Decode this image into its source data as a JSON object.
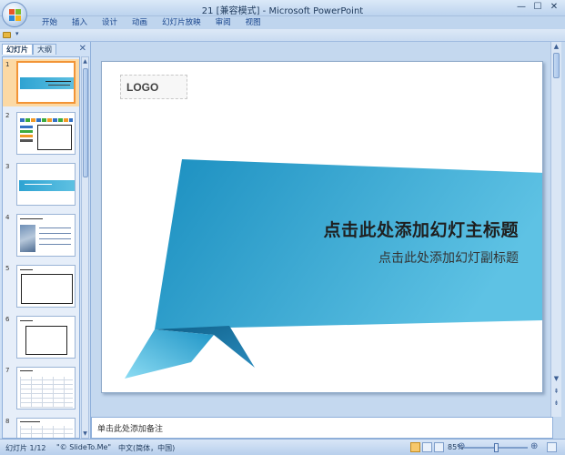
{
  "window": {
    "title": "21 [兼容模式] - Microsoft PowerPoint",
    "controls": [
      "—",
      "☐",
      "✕"
    ]
  },
  "ribbon": {
    "tabs": [
      "开始",
      "插入",
      "设计",
      "动画",
      "幻灯片放映",
      "审阅",
      "视图"
    ]
  },
  "left_pane": {
    "tabs": [
      "幻灯片",
      "大纲"
    ],
    "close": "✕",
    "slide_numbers": [
      "1",
      "2",
      "3",
      "4",
      "5",
      "6",
      "7",
      "8"
    ]
  },
  "slide": {
    "logo": "LOGO",
    "title": "点击此处添加幻灯主标题",
    "subtitle": "点击此处添加幻灯副标题",
    "colors": {
      "ribbon_light": "#5ec2e4",
      "ribbon_dark": "#1b8fc0",
      "ribbon_shadow": "#146e98"
    }
  },
  "notes": {
    "placeholder": "单击此处添加备注"
  },
  "status": {
    "slide_counter": "幻灯片 1/12",
    "theme": "\"© SlideTo.Me\"",
    "language": "中文(简体，中国)",
    "zoom": "85%",
    "zoom_minus": "⊖",
    "zoom_plus": "⊕"
  }
}
